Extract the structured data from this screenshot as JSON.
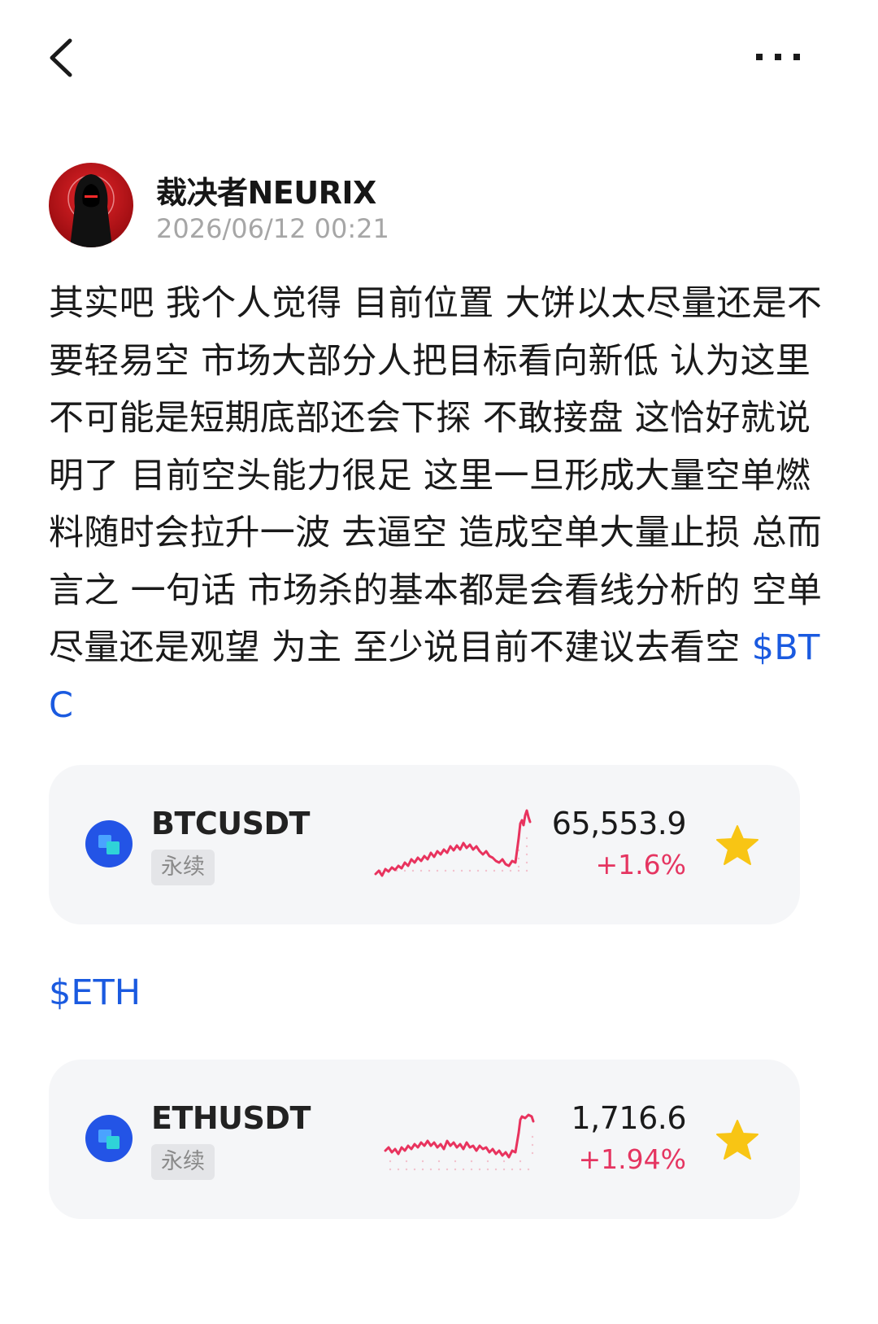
{
  "header": {
    "back_icon": "chevron-left-icon",
    "more_icon": "more-horizontal-icon"
  },
  "author": {
    "name": "裁决者NEURIX",
    "time": "2026/06/12 00:21"
  },
  "post": {
    "text": "其实吧 我个人觉得 目前位置 大饼以太尽量还是不要轻易空 市场大部分人把目标看向新低 认为这里不可能是短期底部还会下探 不敢接盘 这恰好就说明了 目前空头能力很足 这里一旦形成大量空单燃料随时会拉升一波 去逼空 造成空单大量止损 总而言之 一句话 市场杀的基本都是会看线分析的  空单尽量还是观望 为主 至少说目前不建议去看空 ",
    "btc_tag": "$BTC",
    "eth_tag": "$ETH"
  },
  "tickers": [
    {
      "symbol": "BTCUSDT",
      "badge": "永续",
      "price": "65,553.9",
      "change": "+1.6%",
      "trend_pct": 1.6,
      "favorited": true
    },
    {
      "symbol": "ETHUSDT",
      "badge": "永续",
      "price": "1,716.6",
      "change": "+1.94%",
      "trend_pct": 1.94,
      "favorited": true
    }
  ],
  "colors": {
    "link": "#1a5ae0",
    "up": "#e53561",
    "star": "#f8c514",
    "logo_blue": "#2354e6",
    "logo_cyan": "#2fd3d8"
  }
}
